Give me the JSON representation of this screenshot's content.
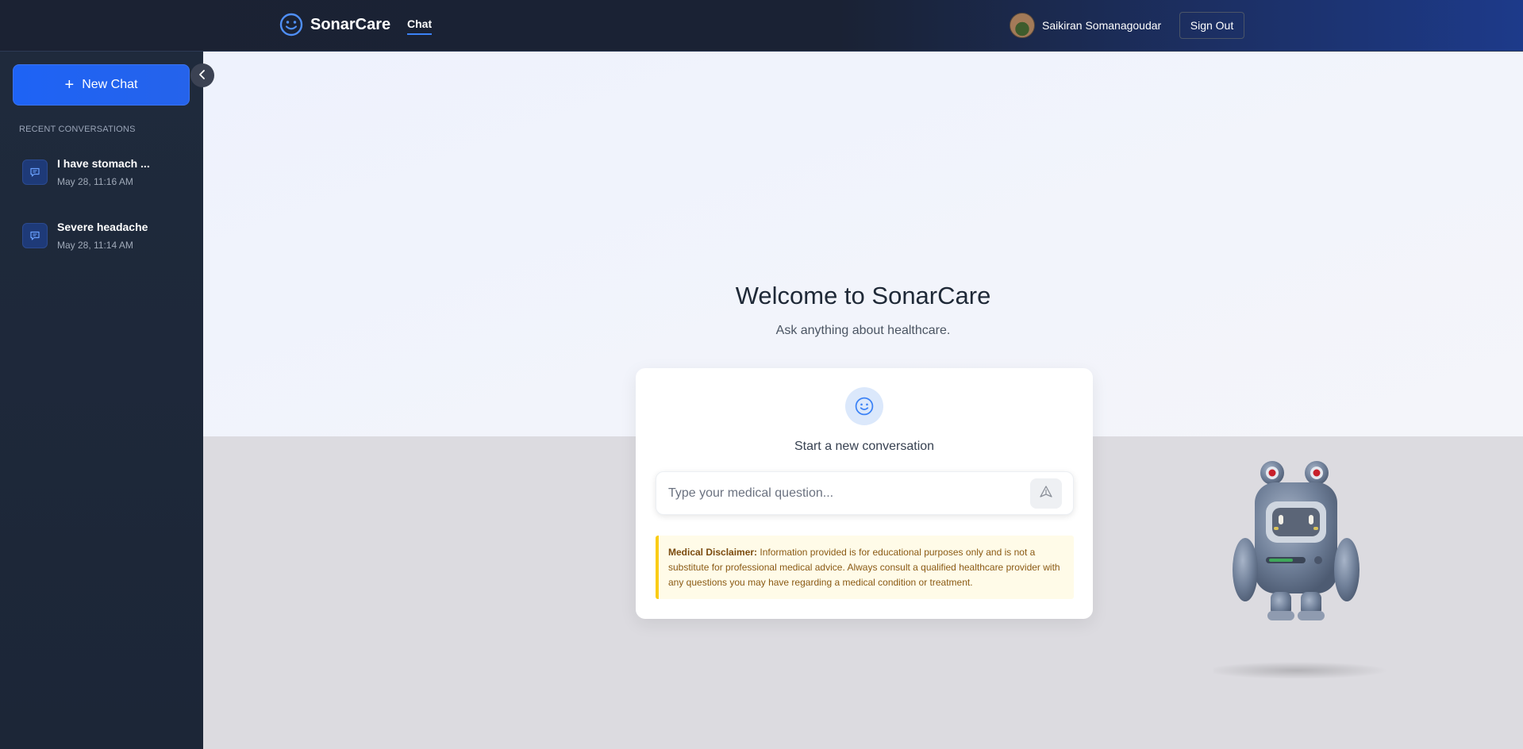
{
  "header": {
    "brand_name": "SonarCare",
    "brand_icon": "smiley-icon",
    "nav_tab": "Chat",
    "user_name": "Saikiran Somanagoudar",
    "sign_out_label": "Sign Out"
  },
  "sidebar": {
    "new_chat_label": "New Chat",
    "recent_heading": "RECENT CONVERSATIONS",
    "conversations": [
      {
        "title": "I have stomach ...",
        "date": "May 28, 11:16 AM"
      },
      {
        "title": "Severe headache",
        "date": "May 28, 11:14 AM"
      }
    ]
  },
  "main": {
    "welcome_title": "Welcome to SonarCare",
    "welcome_subtitle": "Ask anything about healthcare.",
    "card_title": "Start a new conversation",
    "input_placeholder": "Type your medical question...",
    "disclaimer_label": "Medical Disclaimer:",
    "disclaimer_text": "Information provided is for educational purposes only and is not a substitute for professional medical advice. Always consult a qualified healthcare provider with any questions you may have regarding a medical condition or treatment."
  },
  "colors": {
    "accent": "#2563eb",
    "navbar_dark": "#1b2233",
    "navbar_blue": "#1d3a8a",
    "sidebar_bg": "#1f2a3c",
    "disclaimer_border": "#facc15"
  }
}
